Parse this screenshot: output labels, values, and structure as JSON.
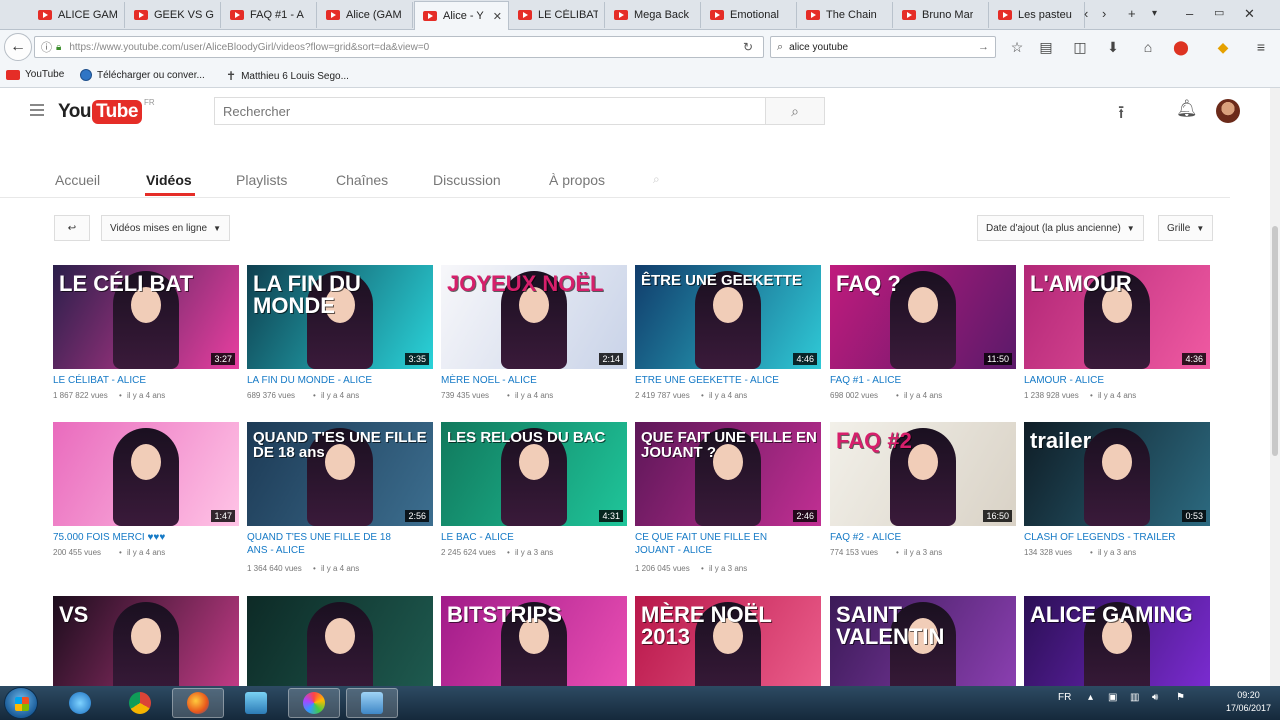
{
  "browser": {
    "tabs": [
      {
        "label": "ALICE GAM"
      },
      {
        "label": "GEEK VS G"
      },
      {
        "label": "FAQ #1 - A"
      },
      {
        "label": "Alice (GAM"
      },
      {
        "label": "Alice - Y",
        "active": true
      },
      {
        "label": "LE CÉLIBAT"
      },
      {
        "label": "Mega Back"
      },
      {
        "label": "Emotional"
      },
      {
        "label": "The Chain"
      },
      {
        "label": "Bruno Mar"
      },
      {
        "label": "Les pasteu"
      }
    ],
    "url": "https://www.youtube.com/user/AliceBloodyGirl/videos?flow=grid&sort=da&view=0",
    "search_value": "alice youtube",
    "bookmarks": [
      {
        "label": "YouTube",
        "icon": "youtube-icon"
      },
      {
        "label": "Télécharger ou conver...",
        "icon": "globe-icon"
      },
      {
        "label": "Matthieu 6 Louis Sego...",
        "icon": "cross-icon"
      }
    ]
  },
  "masthead": {
    "logo_you": "You",
    "logo_tube": "Tube",
    "logo_region": "FR",
    "search_placeholder": "Rechercher"
  },
  "channel_tabs": [
    {
      "label": "Accueil"
    },
    {
      "label": "Vidéos",
      "active": true
    },
    {
      "label": "Playlists"
    },
    {
      "label": "Chaînes"
    },
    {
      "label": "Discussion"
    },
    {
      "label": "À propos"
    }
  ],
  "filters": {
    "upload_type": "Vidéos mises en ligne",
    "sort": "Date d'ajout (la plus ancienne)",
    "view": "Grille"
  },
  "videos": [
    {
      "title": "LE CÉLIBAT - ALICE",
      "title2": "",
      "views": "1 867 822 vues",
      "age": "il y a 4 ans",
      "duration": "3:27",
      "thumb_text": "LE CÉLI BAT",
      "bg1": "#2a1f4a",
      "bg2": "#e83fa0"
    },
    {
      "title": "LA FIN DU MONDE - ALICE",
      "title2": "",
      "views": "689 376 vues",
      "age": "il y a 4 ans",
      "duration": "3:35",
      "thumb_text": "LA FIN DU MONDE",
      "bg1": "#0f3f4f",
      "bg2": "#2ad3d9"
    },
    {
      "title": "MÈRE NOEL - ALICE",
      "title2": "",
      "views": "739 435 vues",
      "age": "il y a 4 ans",
      "duration": "2:14",
      "thumb_text": "JOYEUX NOËL",
      "bg1": "#f7f7fa",
      "bg2": "#c9d3e8"
    },
    {
      "title": "ETRE UNE GEEKETTE - ALICE",
      "title2": "",
      "views": "2 419 787 vues",
      "age": "il y a 4 ans",
      "duration": "4:46",
      "thumb_text": "ÊTRE UNE GEEKETTE",
      "bg1": "#113c6b",
      "bg2": "#2fc9d6"
    },
    {
      "title": "FAQ #1 - ALICE",
      "title2": "",
      "views": "698 002 vues",
      "age": "il y a 4 ans",
      "duration": "11:50",
      "thumb_text": "FAQ ?",
      "bg1": "#c01b7d",
      "bg2": "#5b1a6a"
    },
    {
      "title": "LAMOUR - ALICE",
      "title2": "",
      "views": "1 238 928 vues",
      "age": "il y a 4 ans",
      "duration": "4:36",
      "thumb_text": "L'AMOUR",
      "bg1": "#b22777",
      "bg2": "#f05aa2"
    },
    {
      "title": "75.000 FOIS MERCI ♥♥♥",
      "title2": "",
      "views": "200 455 vues",
      "age": "il y a 4 ans",
      "duration": "1:47",
      "thumb_text": "",
      "bg1": "#e96bbd",
      "bg2": "#ffc4e6"
    },
    {
      "title": "QUAND T'ES UNE FILLE DE 18",
      "title2": "ANS - ALICE",
      "views": "1 364 640 vues",
      "age": "il y a 4 ans",
      "duration": "2:56",
      "thumb_text": "QUAND T'ES UNE FILLE DE 18 ans",
      "bg1": "#1d3a55",
      "bg2": "#3c6e8f"
    },
    {
      "title": "LE BAC - ALICE",
      "title2": "",
      "views": "2 245 624 vues",
      "age": "il y a 3 ans",
      "duration": "4:31",
      "thumb_text": "LES RELOUS DU BAC",
      "bg1": "#11795d",
      "bg2": "#1fc59a"
    },
    {
      "title": "CE QUE FAIT UNE FILLE EN",
      "title2": "JOUANT - ALICE",
      "views": "1 206 045 vues",
      "age": "il y a 3 ans",
      "duration": "2:46",
      "thumb_text": "QUE FAIT UNE FILLE EN JOUANT ?",
      "bg1": "#5d1758",
      "bg2": "#c12f93"
    },
    {
      "title": "FAQ #2 - ALICE",
      "title2": "",
      "views": "774 153 vues",
      "age": "il y a 3 ans",
      "duration": "16:50",
      "thumb_text": "FAQ #2",
      "bg1": "#f2f0e9",
      "bg2": "#d9d2c6"
    },
    {
      "title": "CLASH OF LEGENDS - TRAILER",
      "title2": "",
      "views": "134 328 vues",
      "age": "il y a 3 ans",
      "duration": "0:53",
      "thumb_text": "trailer",
      "bg1": "#0f1d26",
      "bg2": "#2c6a80"
    },
    {
      "title": "",
      "title2": "",
      "views": "",
      "age": "",
      "duration": "",
      "thumb_text": "VS",
      "bg1": "#1b0d1c",
      "bg2": "#c03b85"
    },
    {
      "title": "",
      "title2": "",
      "views": "",
      "age": "",
      "duration": "",
      "thumb_text": "",
      "bg1": "#0d2a26",
      "bg2": "#1e5a4f"
    },
    {
      "title": "",
      "title2": "",
      "views": "",
      "age": "",
      "duration": "",
      "thumb_text": "BITSTRIPS",
      "bg1": "#a11b89",
      "bg2": "#ea4fb3"
    },
    {
      "title": "",
      "title2": "",
      "views": "",
      "age": "",
      "duration": "",
      "thumb_text": "MÈRE NOËL 2013",
      "bg1": "#b8174a",
      "bg2": "#eb5d8b"
    },
    {
      "title": "",
      "title2": "",
      "views": "",
      "age": "",
      "duration": "",
      "thumb_text": "SAINT VALENTIN",
      "bg1": "#3b1a57",
      "bg2": "#8a3fb0"
    },
    {
      "title": "",
      "title2": "",
      "views": "",
      "age": "",
      "duration": "",
      "thumb_text": "ALICE GAMING",
      "bg1": "#2b0f55",
      "bg2": "#7a2bd0"
    }
  ],
  "taskbar": {
    "lang": "FR",
    "time": "09:20",
    "date": "17/06/2017"
  },
  "colors": {
    "youtube_red": "#e52d27",
    "link_blue": "#167ac6",
    "taskbar": "#1e3a52"
  }
}
